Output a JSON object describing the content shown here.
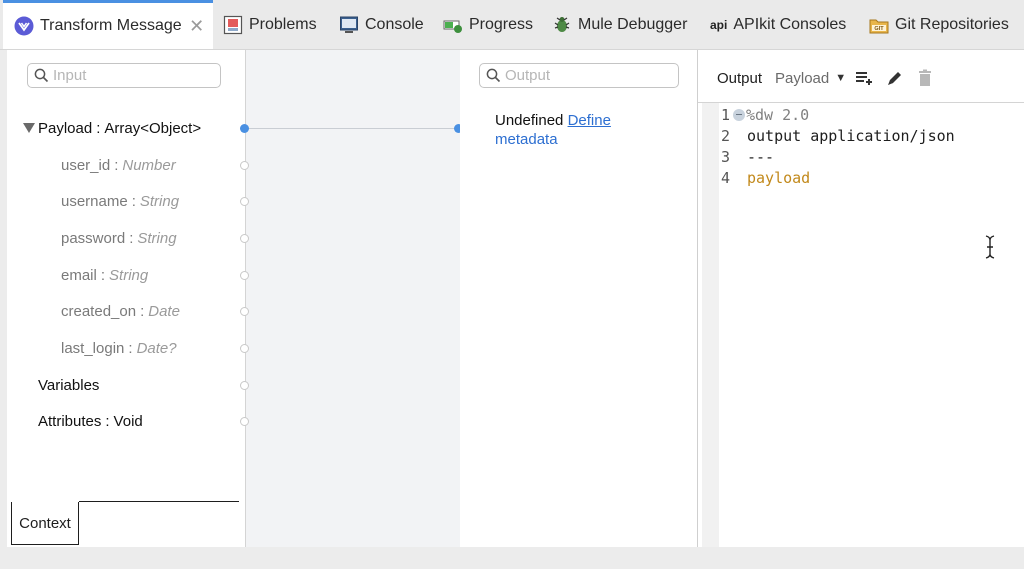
{
  "tabs": [
    {
      "label": "Transform Message",
      "icon": "dataweave-icon",
      "active": true
    },
    {
      "label": "Problems",
      "icon": "problems-icon"
    },
    {
      "label": "Console",
      "icon": "console-icon"
    },
    {
      "label": "Progress",
      "icon": "progress-icon"
    },
    {
      "label": "Mule Debugger",
      "icon": "debugger-bug-icon"
    },
    {
      "label": "APIkit Consoles",
      "icon": "api-icon",
      "icon_text": "api"
    },
    {
      "label": "Git Repositories",
      "icon": "git-repositories-icon",
      "icon_text": "GIT"
    }
  ],
  "input_panel": {
    "search_placeholder": "Input",
    "tree": {
      "payload": {
        "name": "Payload",
        "type": "Array<Object>",
        "fields": [
          {
            "name": "user_id",
            "type": "Number"
          },
          {
            "name": "username",
            "type": "String"
          },
          {
            "name": "password",
            "type": "String"
          },
          {
            "name": "email",
            "type": "String"
          },
          {
            "name": "created_on",
            "type": "Date"
          },
          {
            "name": "last_login",
            "type": "Date?"
          }
        ]
      },
      "variables": {
        "name": "Variables"
      },
      "attributes": {
        "name": "Attributes",
        "type": "Void"
      }
    },
    "context_tab": "Context"
  },
  "output_panel": {
    "search_placeholder": "Output",
    "undefined_text": "Undefined",
    "define_link": "Define",
    "define_link_2": "metadata"
  },
  "script_panel": {
    "output_label": "Output",
    "target_select": "Payload",
    "lines": [
      {
        "num": "1",
        "text": "%dw 2.0"
      },
      {
        "num": "2",
        "text": "output application/json"
      },
      {
        "num": "3",
        "text": "---"
      },
      {
        "num": "4",
        "text": "payload"
      }
    ]
  },
  "colors": {
    "accent": "#4a90e2",
    "link": "#2d6fd1",
    "keyword": "#c2891b",
    "directive": "#808080"
  }
}
